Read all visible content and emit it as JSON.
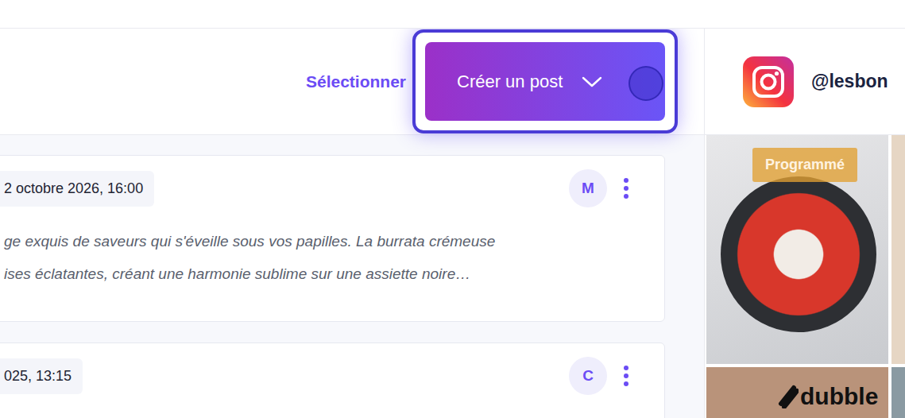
{
  "toolbar": {
    "select_label": "Sélectionner",
    "create_button": {
      "label": "Créer un post",
      "focused": true
    }
  },
  "posts": [
    {
      "date": "2 octobre 2026, 16:00",
      "author_initial": "M",
      "caption": [
        "ge exquis de saveurs qui s'éveille sous vos papilles. La burrata crémeuse",
        "ises éclatantes, créant une harmonie sublime sur une assiette noire…"
      ]
    },
    {
      "date": "025, 13:15",
      "author_initial": "C",
      "caption": []
    }
  ],
  "profile": {
    "handle": "@lesbon"
  },
  "grid": [
    {
      "badge": "Programmé"
    },
    {
      "badge": ""
    },
    {
      "badge": ""
    },
    {
      "badge": ""
    }
  ],
  "watermark": "dubble"
}
